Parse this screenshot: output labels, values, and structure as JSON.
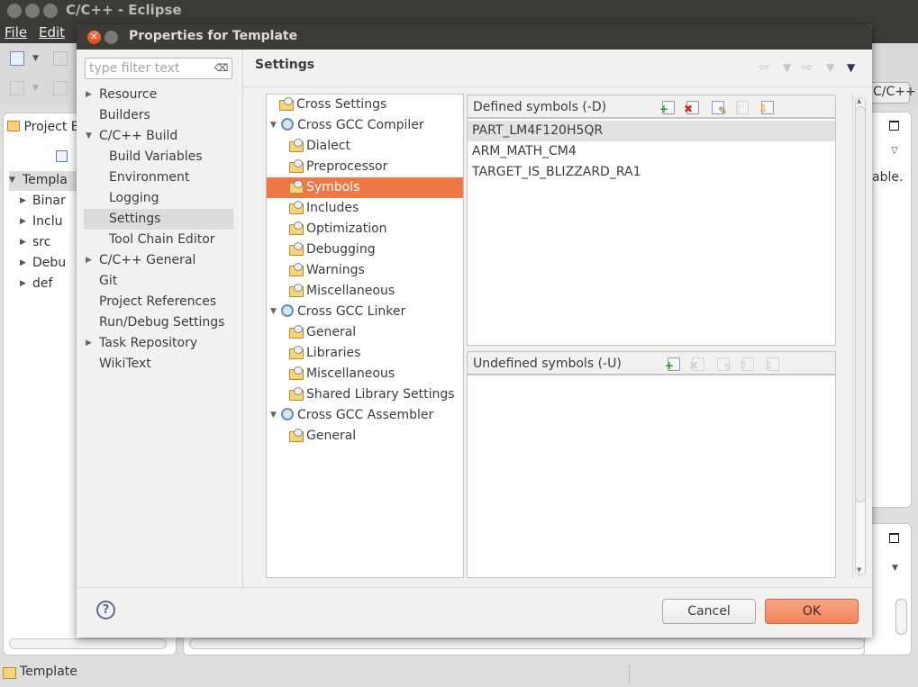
{
  "app": {
    "title": "C/C++ - Eclipse",
    "menu": [
      "File",
      "Edit"
    ],
    "perspective_label": "C/C++",
    "project_explorer_tab": "Project E",
    "project_tree": [
      {
        "label": "Templa",
        "expanded": true,
        "level": 0
      },
      {
        "label": "Binar",
        "level": 1
      },
      {
        "label": "Inclu",
        "level": 1
      },
      {
        "label": "src",
        "level": 1
      },
      {
        "label": "Debu",
        "level": 1
      },
      {
        "label": "def",
        "level": 1
      }
    ],
    "right_panel_text": "able.",
    "status_label": "Template"
  },
  "dialog": {
    "title": "Properties for Template",
    "filter": {
      "placeholder": "type filter text",
      "value": ""
    },
    "nav": [
      {
        "label": "Resource",
        "has_children": true,
        "expanded": false,
        "level": 0
      },
      {
        "label": "Builders",
        "level": 0
      },
      {
        "label": "C/C++ Build",
        "has_children": true,
        "expanded": true,
        "level": 0
      },
      {
        "label": "Build Variables",
        "level": 1
      },
      {
        "label": "Environment",
        "level": 1
      },
      {
        "label": "Logging",
        "level": 1
      },
      {
        "label": "Settings",
        "level": 1,
        "selected": true
      },
      {
        "label": "Tool Chain Editor",
        "level": 1
      },
      {
        "label": "C/C++ General",
        "has_children": true,
        "expanded": false,
        "level": 0
      },
      {
        "label": "Git",
        "level": 0
      },
      {
        "label": "Project References",
        "level": 0
      },
      {
        "label": "Run/Debug Settings",
        "level": 0
      },
      {
        "label": "Task Repository",
        "has_children": true,
        "expanded": false,
        "level": 0
      },
      {
        "label": "WikiText",
        "level": 0
      }
    ],
    "page_title": "Settings",
    "tool_tree": [
      {
        "label": "Cross Settings",
        "icon": "folder-settings-icon",
        "level": 0
      },
      {
        "label": "Cross GCC Compiler",
        "icon": "gear-tool-icon",
        "level": 0,
        "expanded": true
      },
      {
        "label": "Dialect",
        "icon": "folder-settings-icon",
        "level": 1
      },
      {
        "label": "Preprocessor",
        "icon": "folder-settings-icon",
        "level": 1
      },
      {
        "label": "Symbols",
        "icon": "folder-settings-icon",
        "level": 1,
        "selected": true
      },
      {
        "label": "Includes",
        "icon": "folder-settings-icon",
        "level": 1
      },
      {
        "label": "Optimization",
        "icon": "folder-settings-icon",
        "level": 1
      },
      {
        "label": "Debugging",
        "icon": "folder-settings-icon",
        "level": 1
      },
      {
        "label": "Warnings",
        "icon": "folder-settings-icon",
        "level": 1
      },
      {
        "label": "Miscellaneous",
        "icon": "folder-settings-icon",
        "level": 1
      },
      {
        "label": "Cross GCC Linker",
        "icon": "gear-tool-icon",
        "level": 0,
        "expanded": true
      },
      {
        "label": "General",
        "icon": "folder-settings-icon",
        "level": 1
      },
      {
        "label": "Libraries",
        "icon": "folder-settings-icon",
        "level": 1
      },
      {
        "label": "Miscellaneous",
        "icon": "folder-settings-icon",
        "level": 1
      },
      {
        "label": "Shared Library Settings",
        "icon": "folder-settings-icon",
        "level": 1
      },
      {
        "label": "Cross GCC Assembler",
        "icon": "gear-tool-icon",
        "level": 0,
        "expanded": true
      },
      {
        "label": "General",
        "icon": "folder-settings-icon",
        "level": 1
      }
    ],
    "defined_symbols": {
      "label": "Defined symbols (-D)",
      "toolbar": [
        {
          "name": "add",
          "enabled": true
        },
        {
          "name": "delete",
          "enabled": true
        },
        {
          "name": "edit",
          "enabled": true
        },
        {
          "name": "move-up",
          "enabled": false
        },
        {
          "name": "move-down",
          "enabled": true
        }
      ],
      "items": [
        "PART_LM4F120H5QR",
        "ARM_MATH_CM4",
        "TARGET_IS_BLIZZARD_RA1"
      ],
      "selected_index": 0
    },
    "undefined_symbols": {
      "label": "Undefined symbols (-U)",
      "toolbar": [
        {
          "name": "add",
          "enabled": true
        },
        {
          "name": "delete",
          "enabled": false
        },
        {
          "name": "edit",
          "enabled": false
        },
        {
          "name": "move-up",
          "enabled": false
        },
        {
          "name": "move-down",
          "enabled": false
        }
      ],
      "items": []
    },
    "buttons": {
      "cancel": "Cancel",
      "ok": "OK"
    },
    "colors": {
      "selection": "#f07746",
      "ok_button": "#f1835a"
    }
  }
}
